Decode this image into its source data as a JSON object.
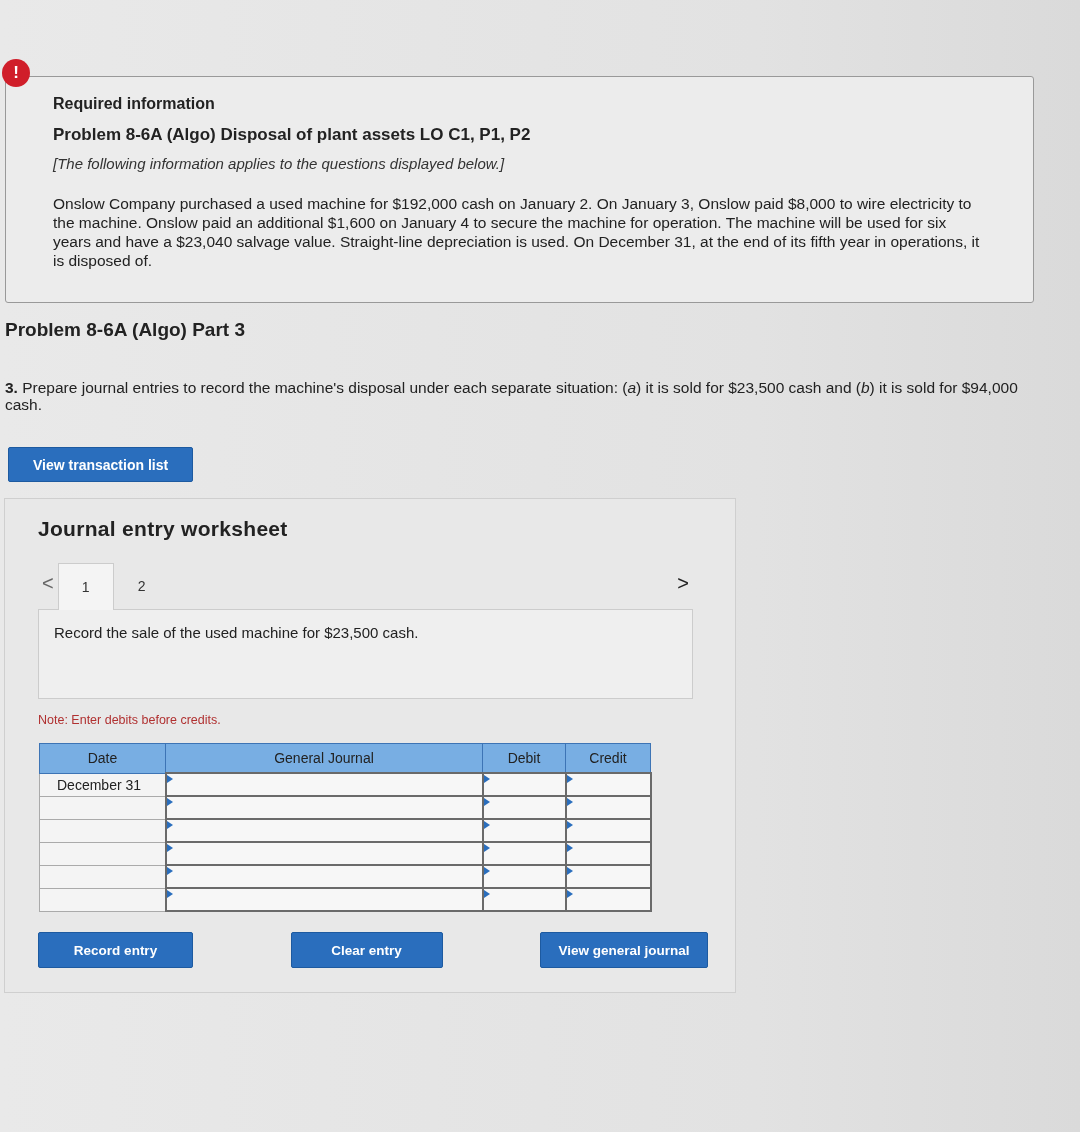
{
  "alert_icon": "!",
  "info": {
    "heading": "Required information",
    "title": "Problem 8-6A (Algo) Disposal of plant assets LO C1, P1, P2",
    "note": "[The following information applies to the questions displayed below.]",
    "body": "Onslow Company purchased a used machine for $192,000 cash on January 2. On January 3, Onslow paid $8,000 to wire electricity to the machine. Onslow paid an additional $1,600 on January 4 to secure the machine for operation. The machine will be used for six years and have a $23,040 salvage value. Straight-line depreciation is used. On December 31, at the end of its fifth year in operations, it is disposed of."
  },
  "part_title": "Problem 8-6A (Algo) Part 3",
  "question": "**3.** Prepare journal entries to record the machine's disposal under each separate situation: (*a*) it is sold for $23,500 cash and (*b*) it is sold for $94,000 cash.",
  "view_button": "View transaction list",
  "worksheet": {
    "title": "Journal entry worksheet",
    "prev": "<",
    "next": ">",
    "tabs": [
      {
        "label": "1",
        "selected": true
      },
      {
        "label": "2",
        "selected": false
      }
    ],
    "instruction": "Record the sale of the used machine for $23,500 cash.",
    "note": "Note: Enter debits before credits.",
    "columns": [
      "Date",
      "General Journal",
      "Debit",
      "Credit"
    ],
    "rows": [
      {
        "date": "December 31"
      },
      {},
      {},
      {},
      {},
      {}
    ],
    "buttons": [
      "Record entry",
      "Clear entry",
      "View general journal"
    ]
  }
}
